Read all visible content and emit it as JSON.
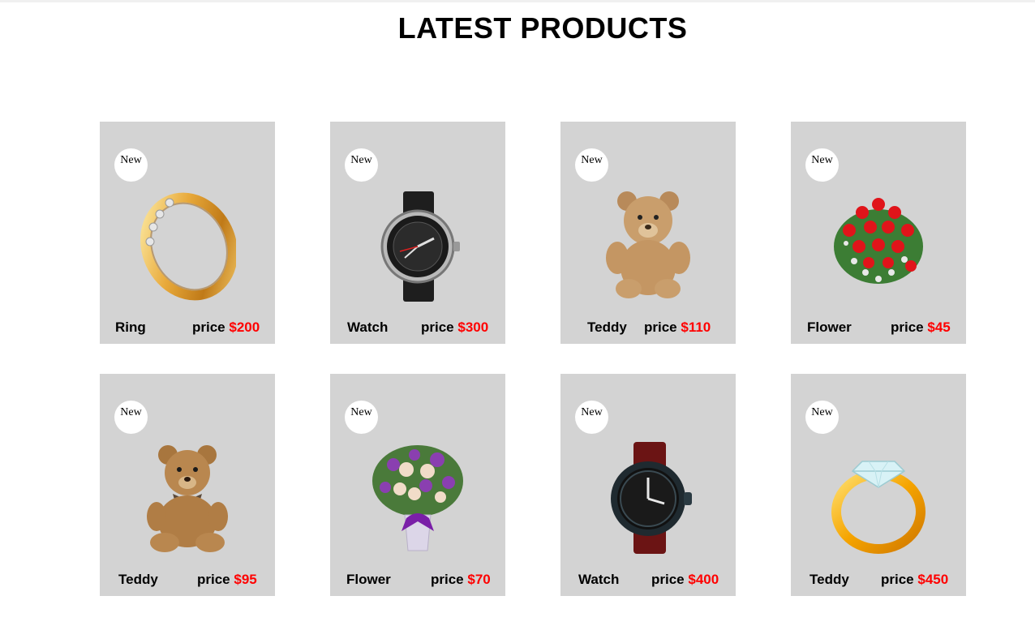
{
  "page": {
    "title": "LATEST PRODUCTS"
  },
  "colors": {
    "card_background": "#d3d3d3",
    "badge_background": "#ffffff",
    "price_amount": "#ff0000"
  },
  "products": [
    {
      "badge": "New",
      "name": "Ring",
      "price_label": "price",
      "price": "$200",
      "image": "gold-ring-with-stones"
    },
    {
      "badge": "New",
      "name": "Watch",
      "price_label": "price",
      "price": "$300",
      "image": "black-strap-wristwatch"
    },
    {
      "badge": "New",
      "name": "Teddy",
      "price_label": "price",
      "price": "$110",
      "image": "teddy-bear"
    },
    {
      "badge": "New",
      "name": "Flower",
      "price_label": "price",
      "price": "$45",
      "image": "red-rose-bouquet"
    },
    {
      "badge": "New",
      "name": "Teddy",
      "price_label": "price",
      "price": "$95",
      "image": "teddy-bear-with-bow"
    },
    {
      "badge": "New",
      "name": "Flower",
      "price_label": "price",
      "price": "$70",
      "image": "purple-flower-vase"
    },
    {
      "badge": "New",
      "name": "Watch",
      "price_label": "price",
      "price": "$400",
      "image": "leather-strap-wristwatch"
    },
    {
      "badge": "New",
      "name": "Teddy",
      "price_label": "price",
      "price": "$450",
      "image": "diamond-ring"
    }
  ]
}
